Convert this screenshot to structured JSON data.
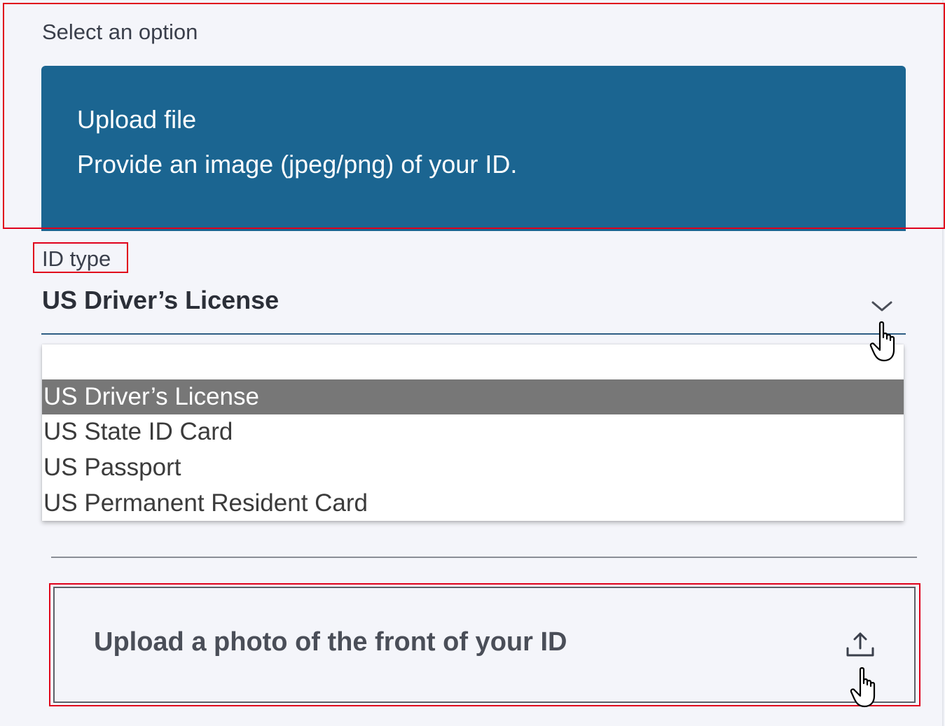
{
  "option_section": {
    "label": "Select an option",
    "card": {
      "title": "Upload file",
      "description": "Provide an image (jpeg/png) of your ID."
    }
  },
  "id_type": {
    "label": "ID type",
    "selected_value": "US Driver’s License",
    "options": [
      "",
      "US Driver’s License",
      "US State ID Card",
      "US Passport",
      "US Permanent Resident Card"
    ],
    "highlighted_index": 1
  },
  "upload": {
    "label": "Upload a photo of the front of your ID",
    "icon": "upload-icon"
  },
  "colors": {
    "card_bg": "#1b6591",
    "highlight_bg": "#777777",
    "annotation_red": "#e0001b",
    "page_bg": "#f4f5fa"
  }
}
